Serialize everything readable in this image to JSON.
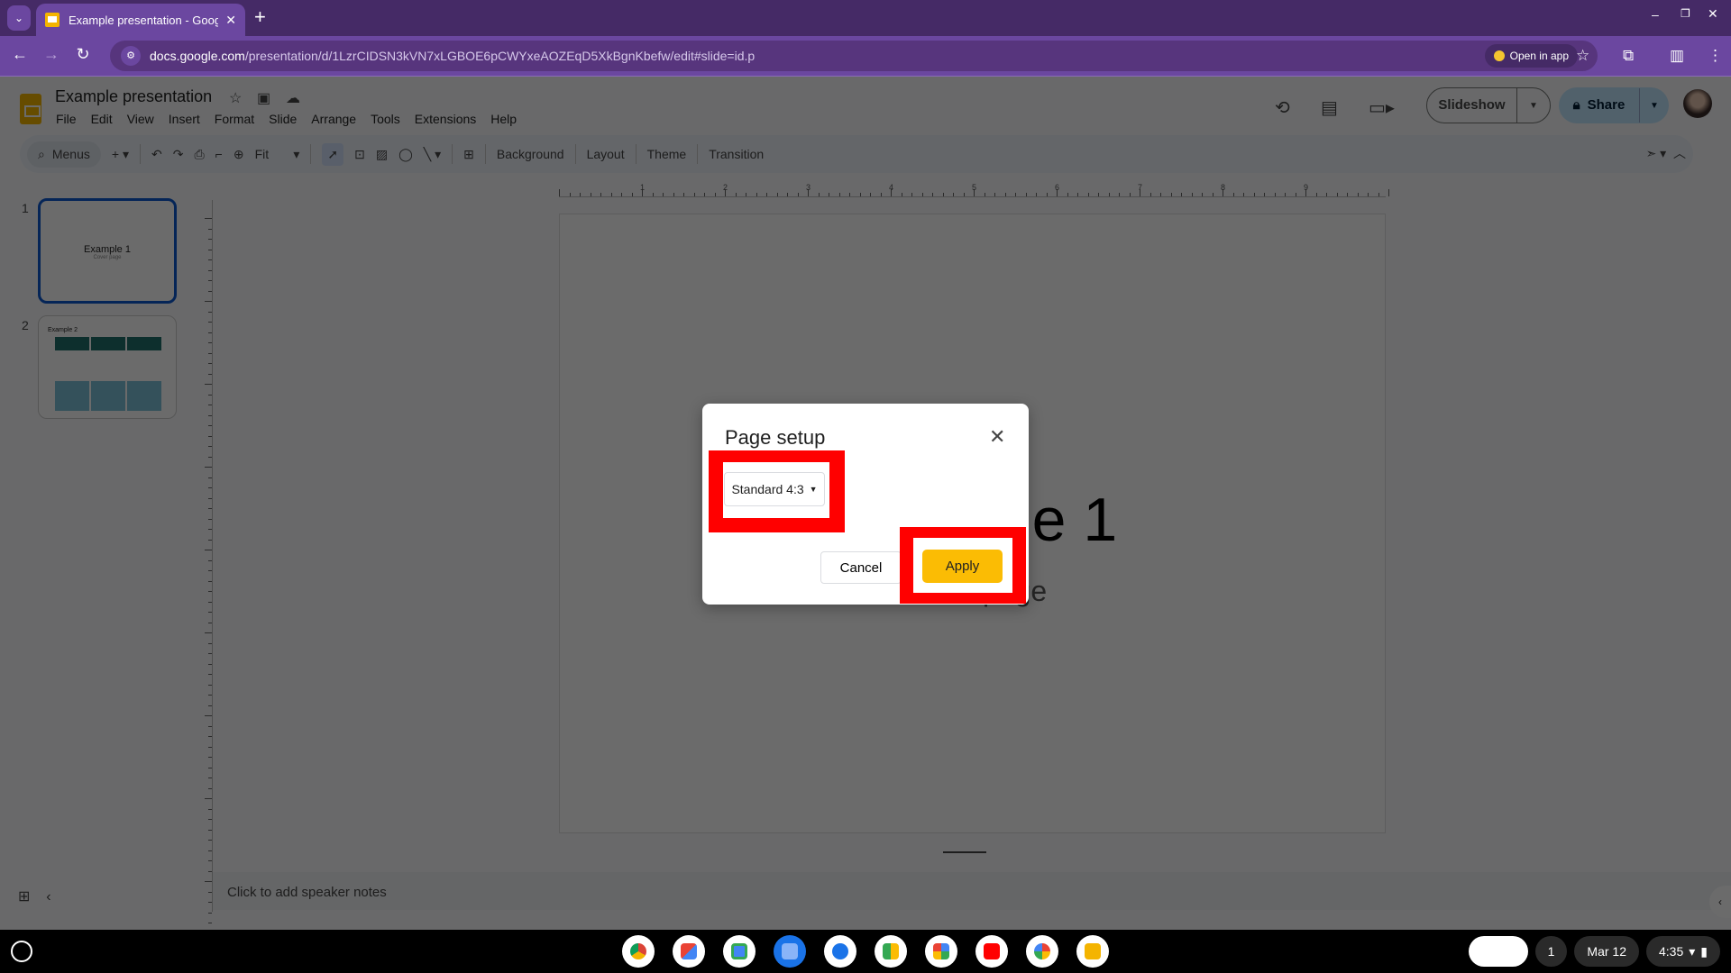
{
  "browser": {
    "tab_title": "Example presentation - Google Slides",
    "url_host": "docs.google.com",
    "url_path": "/presentation/d/1LzrCIDSN3kVN7xLGBOE6pCWYxeAOZEqD5XkBgnKbefw/edit#slide=id.p",
    "open_in_app": "Open in app"
  },
  "doc": {
    "title": "Example presentation",
    "menus": [
      "File",
      "Edit",
      "View",
      "Insert",
      "Format",
      "Slide",
      "Arrange",
      "Tools",
      "Extensions",
      "Help"
    ],
    "slideshow": "Slideshow",
    "share": "Share"
  },
  "toolbar": {
    "search": "Menus",
    "zoom": "Fit",
    "background": "Background",
    "layout": "Layout",
    "theme": "Theme",
    "transition": "Transition"
  },
  "ruler": [
    "1",
    "2",
    "3",
    "4",
    "5",
    "6",
    "7",
    "8",
    "9"
  ],
  "thumbnails": [
    {
      "num": "1",
      "title": "Example 1",
      "subtitle": "Cover page"
    },
    {
      "num": "2",
      "title": "Example 2"
    }
  ],
  "slide": {
    "title": "Example 1",
    "subtitle": "Cover page"
  },
  "notes": "Click to add speaker notes",
  "dialog": {
    "title": "Page setup",
    "select_value": "Standard 4:3",
    "cancel": "Cancel",
    "apply": "Apply",
    "apply_color": "#fbbc04",
    "highlight_color": "#ff0000"
  },
  "taskbar": {
    "apps": [
      "Chrome",
      "Gmail",
      "Calendar",
      "Files",
      "Messages",
      "Meet",
      "Play Store",
      "YouTube",
      "Photos",
      "Slides"
    ],
    "notifications": "1",
    "date": "Mar 12",
    "time": "4:35"
  }
}
